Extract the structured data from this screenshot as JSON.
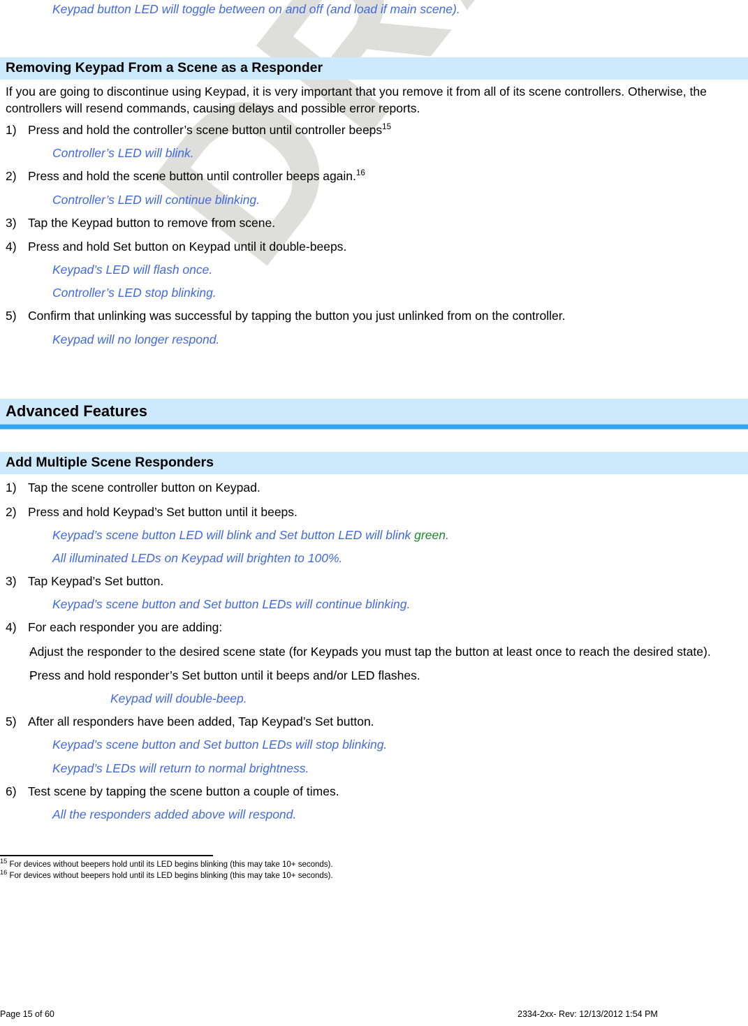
{
  "watermark": {
    "text": "DRAFT",
    "color": "#dededd"
  },
  "colors": {
    "note_blue": "#4169E1",
    "green": "#1a8a28",
    "heading_band": "#cdeafc",
    "heading_rule": "#3aa3ee"
  },
  "top_note": "Keypad button LED will toggle between on and off (and load if main scene).",
  "section_removing": {
    "heading": "Removing Keypad From a Scene as a Responder",
    "intro": "If you are going to discontinue using Keypad, it is very important that you remove it from all of its scene controllers. Otherwise, the controllers will resend commands, causing delays and possible error reports.",
    "steps": [
      {
        "marker": "1)",
        "text": "Press and hold the controller’s scene button until controller beeps",
        "footnote_ref": "15"
      },
      {
        "marker": "2)",
        "text": "Press and hold the scene button until controller beeps again.",
        "footnote_ref": "16"
      },
      {
        "marker": "3)",
        "text": "Tap the Keypad button to remove from scene."
      },
      {
        "marker": "4)",
        "text": "Press and hold Set button on Keypad until it double-beeps."
      },
      {
        "marker": "5)",
        "text": "Confirm that unlinking was successful by tapping the button you just unlinked from on the controller."
      }
    ],
    "note_1": "Controller’s LED will blink.",
    "note_2": "Controller’s LED will continue blinking.",
    "note_4a": "Keypad’s LED will flash once.",
    "note_4b": "Controller’s LED stop blinking.",
    "note_5": "Keypad will no longer respond."
  },
  "section_advanced": {
    "heading": "Advanced Features"
  },
  "section_responders": {
    "heading": "Add Multiple Scene Responders",
    "steps": [
      {
        "marker": "1)",
        "text": "Tap the scene controller button on Keypad."
      },
      {
        "marker": "2)",
        "text": "Press and hold Keypad’s Set button until it beeps."
      },
      {
        "marker": "3)",
        "text": "Tap Keypad’s Set button."
      },
      {
        "marker": "4)",
        "text": "For each responder you are adding:"
      },
      {
        "marker": "5)",
        "text": "After all responders have been added, Tap Keypad’s Set button."
      },
      {
        "marker": "6)",
        "text": "Test scene by tapping the scene button a couple of times."
      }
    ],
    "note_2a_prefix": "Keypad’s scene button LED will blink and Set button LED will blink ",
    "note_2a_green": "green",
    "note_2a_suffix": ".",
    "note_2b": "All illuminated LEDs on Keypad will brighten to 100%.",
    "note_3": "Keypad’s scene button and Set button LEDs will continue blinking.",
    "sub_items": [
      {
        "marker": "-",
        "text": "Adjust the responder to the desired scene state (for Keypads you must tap the button at least once to reach the desired state)."
      },
      {
        "marker": "-",
        "text": "Press and hold responder’s Set button until it beeps and/or LED flashes."
      }
    ],
    "note_sub": "Keypad will double-beep.",
    "note_5a": "Keypad’s scene button and Set button LEDs will stop blinking.",
    "note_5b": "Keypad’s LEDs will return to normal brightness.",
    "note_6": "All the responders added above will respond."
  },
  "footnotes": [
    {
      "marker": "15",
      "text": "For devices without beepers hold until its LED begins blinking (this may take 10+ seconds)."
    },
    {
      "marker": "16",
      "text": "For devices without beepers hold until its LED begins blinking (this may take 10+ seconds)."
    }
  ],
  "footer": {
    "left": "Page 15 of 60",
    "right": "2334-2xx- Rev: 12/13/2012 1:54 PM"
  }
}
